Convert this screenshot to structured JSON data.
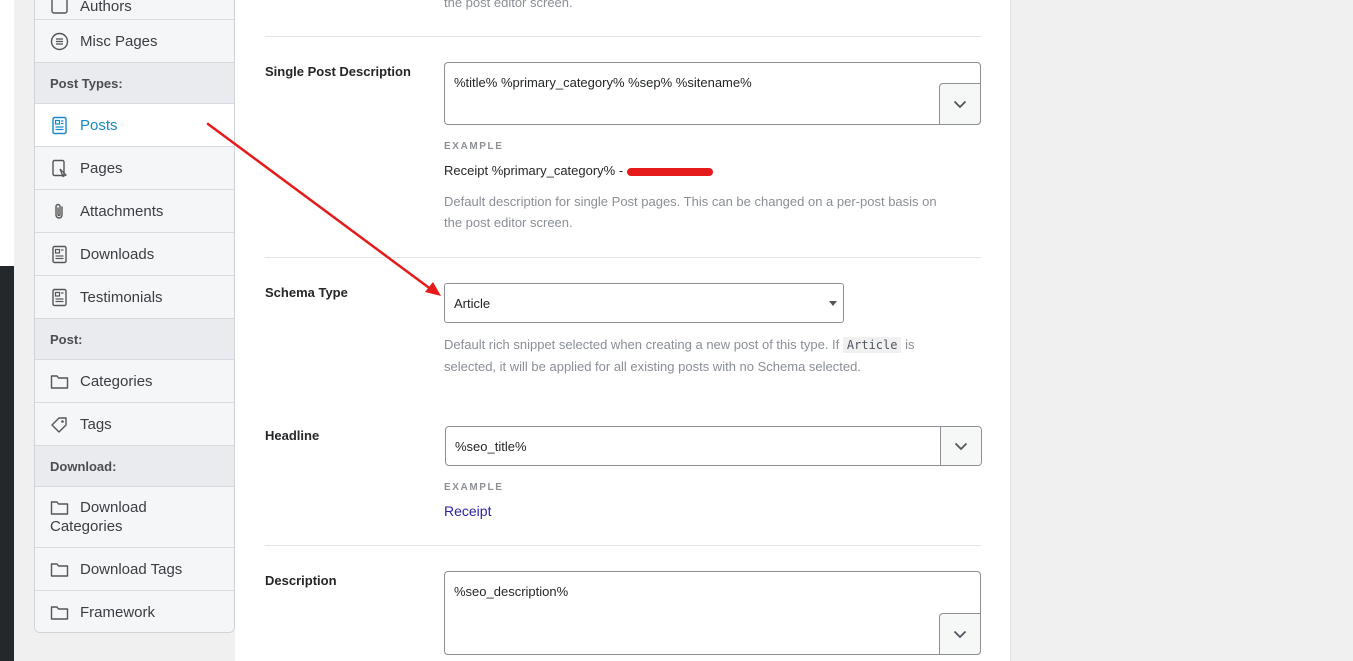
{
  "sidebar": {
    "items": [
      {
        "label": "Authors",
        "icon": "authors-icon"
      },
      {
        "label": "Misc Pages",
        "icon": "list-circle-icon"
      },
      {
        "label": "Posts",
        "icon": "post-doc-icon",
        "active": true
      },
      {
        "label": "Pages",
        "icon": "page-doc-icon"
      },
      {
        "label": "Attachments",
        "icon": "paperclip-icon"
      },
      {
        "label": "Downloads",
        "icon": "doc-icon"
      },
      {
        "label": "Testimonials",
        "icon": "doc-icon"
      },
      {
        "label": "Categories",
        "icon": "folder-icon"
      },
      {
        "label": "Tags",
        "icon": "tag-icon"
      },
      {
        "label": "Download Categories",
        "label_line1": "Download",
        "label_line2": "Categories",
        "icon": "folder-icon"
      },
      {
        "label": "Download Tags",
        "icon": "folder-icon"
      },
      {
        "label": "Framework",
        "icon": "folder-icon"
      }
    ],
    "headers": {
      "post_types": "Post Types:",
      "post": "Post:",
      "download": "Download:"
    }
  },
  "main": {
    "top_help_tail": "the post editor screen.",
    "single_post_description": {
      "label": "Single Post Description",
      "value": "%title% %primary_category% %sep% %sitename%",
      "example_label": "EXAMPLE",
      "example_text": "Receipt %primary_category% -",
      "help_line1": "Default description for single Post pages. This can be changed on a per-post basis on",
      "help_line2": "the post editor screen."
    },
    "schema_type": {
      "label": "Schema Type",
      "value": "Article",
      "help_pre": "Default rich snippet selected when creating a new post of this type. If",
      "help_code": "Article",
      "help_post": "is",
      "help_line2": "selected, it will be applied for all existing posts with no Schema selected."
    },
    "headline": {
      "label": "Headline",
      "value": "%seo_title%",
      "example_label": "EXAMPLE",
      "example_text": "Receipt"
    },
    "description": {
      "label": "Description",
      "value": "%seo_description%"
    }
  },
  "colors": {
    "accent": "#1589c9",
    "annotation_arrow": "#e51b1b",
    "example_link": "#2a1fa5"
  }
}
